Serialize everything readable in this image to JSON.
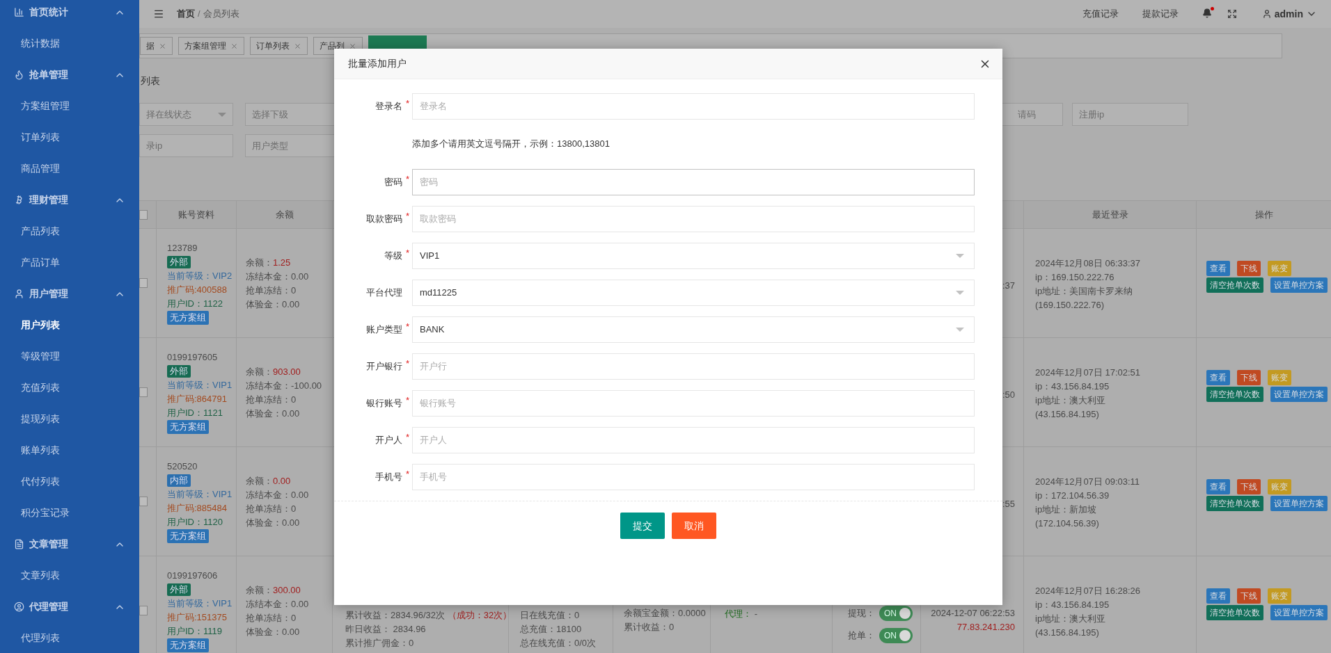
{
  "sidebar": {
    "groups": [
      {
        "label": "首页统计",
        "expanded": true,
        "items": [
          {
            "label": "统计数据",
            "selected": false
          }
        ]
      },
      {
        "label": "抢单管理",
        "expanded": true,
        "items": [
          {
            "label": "方案组管理",
            "selected": false
          },
          {
            "label": "订单列表",
            "selected": false
          },
          {
            "label": "商品管理",
            "selected": false
          }
        ]
      },
      {
        "label": "理财管理",
        "expanded": true,
        "items": [
          {
            "label": "产品列表",
            "selected": false
          },
          {
            "label": "产品订单",
            "selected": false
          }
        ]
      },
      {
        "label": "用户管理",
        "expanded": true,
        "items": [
          {
            "label": "用户列表",
            "selected": true
          },
          {
            "label": "等级管理",
            "selected": false
          },
          {
            "label": "充值列表",
            "selected": false
          },
          {
            "label": "提现列表",
            "selected": false
          },
          {
            "label": "账单列表",
            "selected": false
          },
          {
            "label": "代付列表",
            "selected": false
          },
          {
            "label": "积分宝记录",
            "selected": false
          }
        ]
      },
      {
        "label": "文章管理",
        "expanded": true,
        "items": [
          {
            "label": "文章列表",
            "selected": false
          }
        ]
      },
      {
        "label": "代理管理",
        "expanded": true,
        "items": [
          {
            "label": "代理列表",
            "selected": false
          }
        ]
      }
    ]
  },
  "topbar": {
    "breadcrumb": [
      "首页",
      "会员列表"
    ],
    "separator": "/",
    "links": [
      "充值记录",
      "提款记录"
    ],
    "unread": true,
    "user": "admin"
  },
  "tabs": [
    {
      "label": "据",
      "selected": false
    },
    {
      "label": "方案组管理",
      "selected": false
    },
    {
      "label": "订单列表",
      "selected": false
    },
    {
      "label": "产品列",
      "selected": false
    },
    {
      "selected": true
    }
  ],
  "page_title": "列表",
  "filters": {
    "row_1": [
      {
        "kind": "select",
        "placeholder": "择在线状态"
      },
      {
        "kind": "input",
        "placeholder": "选择下级"
      }
    ],
    "row_1_right": [
      {
        "kind": "input",
        "placeholder": "请码"
      },
      {
        "kind": "input",
        "placeholder": "注册ip"
      }
    ],
    "row_2": [
      {
        "kind": "input",
        "placeholder": "录ip"
      },
      {
        "kind": "input",
        "placeholder": "用户类型"
      }
    ]
  },
  "table": {
    "select_all_checked": false,
    "columns": {
      "account": "账号资料",
      "balance": "余额",
      "last_login": "最近登录",
      "actions": "操作"
    },
    "rows": [
      {
        "checked": false,
        "account": {
          "name": "123789",
          "tag": {
            "kind": "external",
            "label": "外部"
          },
          "level": "当前等级：VIP2",
          "promo": "推广码:400588",
          "user_id": "用户ID：1122",
          "group": "无方案组"
        },
        "balance": {
          "label": "余额：",
          "value": "1.25",
          "lines": [
            "冻结本金：0.00",
            "抢单冻结：0",
            "体验金：0.00"
          ]
        },
        "register": [
          ":37"
        ],
        "last_login": [
          "2024年12月08日 06:33:37",
          "ip：169.150.222.76",
          "ip地址：美国南卡罗来纳",
          "(169.150.222.76)"
        ],
        "actions": [
          "查看",
          "下线",
          "账变",
          "清空抢单次数",
          "设置单控方案"
        ]
      },
      {
        "checked": false,
        "account": {
          "name": "0199197605",
          "tag": {
            "kind": "external",
            "label": "外部"
          },
          "level": "当前等级：VIP1",
          "promo": "推广码:864791",
          "user_id": "用户ID：1121",
          "group": "无方案组"
        },
        "balance": {
          "label": "余额：",
          "value": "903.00",
          "lines": [
            "冻结本金：-100.00",
            "抢单冻结：0",
            "体验金：0.00"
          ]
        },
        "register": [
          ":50"
        ],
        "last_login": [
          "2024年12月07日 17:02:51",
          "ip：43.156.84.195",
          "ip地址：澳大利亚",
          "(43.156.84.195)"
        ],
        "actions": [
          "查看",
          "下线",
          "账变",
          "清空抢单次数",
          "设置单控方案"
        ]
      },
      {
        "checked": false,
        "account": {
          "name": "520520",
          "tag": {
            "kind": "internal",
            "label": "内部"
          },
          "level": "当前等级：VIP1",
          "promo": "推广码:885484",
          "user_id": "用户ID：1120",
          "group": "无方案组"
        },
        "balance": {
          "label": "余额：",
          "value": "0.00",
          "lines": [
            "冻结本金：0.00",
            "抢单冻结：0",
            "体验金：0.00"
          ]
        },
        "register": [
          ":55"
        ],
        "last_login": [
          "2024年12月07日 09:03:11",
          "ip：172.104.56.39",
          "ip地址：新加坡",
          "(172.104.56.39)"
        ],
        "actions": [
          "查看",
          "下线",
          "账变",
          "清空抢单次数",
          "设置单控方案"
        ]
      },
      {
        "checked": false,
        "account": {
          "name": "0199197606",
          "tag": {
            "kind": "external",
            "label": "外部"
          },
          "level": "当前等级：VIP1",
          "promo": "推广码:151375",
          "user_id": "用户ID：1119",
          "group": "无方案组"
        },
        "balance": {
          "label": "余额：",
          "value": "300.00",
          "lines": [
            "冻结本金：0.00",
            "抢单冻结：0",
            "体验金：0.00"
          ]
        },
        "income": {
          "lines": [
            "累计收益：2834.96/32次",
            "昨日收益： 2834.96",
            "累计推广佣金：0"
          ],
          "note": "（成功：32次）"
        },
        "recharge": [
          "日在线充值：0",
          "总充值：18100",
          "总在线充值：0/0次"
        ],
        "yuebao": [
          "余额宝金额：0.0000",
          "累计收益：0"
        ],
        "agent": {
          "label": "代理：",
          "value": "-"
        },
        "switches": [
          {
            "label": "提现：",
            "on": true,
            "text": "ON"
          },
          {
            "label": "抢单：",
            "on": true,
            "text": "ON"
          }
        ],
        "register": [
          "2024-12-07 06:22:53",
          "77.83.241.230"
        ],
        "last_login": [
          "2024年12月07日 16:28:26",
          "ip：43.156.84.195",
          "ip地址：澳大利亚",
          "(43.156.84.195)"
        ],
        "actions": [
          "查看",
          "下线",
          "账变",
          "清空抢单次数",
          "设置单控方案"
        ]
      }
    ]
  },
  "dialog": {
    "title": "批量添加用户",
    "required_mark": "*",
    "fields": [
      {
        "kind": "input",
        "label": "登录名",
        "required": true,
        "placeholder": "登录名",
        "focused": false
      },
      {
        "kind": "hint",
        "text": "添加多个请用英文逗号隔开，示例：13800,13801"
      },
      {
        "kind": "input",
        "label": "密码",
        "required": true,
        "placeholder": "密码",
        "focused": true
      },
      {
        "kind": "input",
        "label": "取款密码",
        "required": true,
        "placeholder": "取款密码",
        "focused": false
      },
      {
        "kind": "select",
        "label": "等级",
        "required": true,
        "value": "VIP1",
        "focused": false
      },
      {
        "kind": "select",
        "label": "平台代理",
        "required": false,
        "value": "md11225",
        "focused": false
      },
      {
        "kind": "select",
        "label": "账户类型",
        "required": true,
        "value": "BANK",
        "focused": false
      },
      {
        "kind": "input",
        "label": "开户银行",
        "required": true,
        "placeholder": "开户行",
        "focused": false
      },
      {
        "kind": "input",
        "label": "银行账号",
        "required": true,
        "placeholder": "银行账号",
        "focused": false
      },
      {
        "kind": "input",
        "label": "开户人",
        "required": true,
        "placeholder": "开户人",
        "focused": false
      },
      {
        "kind": "input",
        "label": "手机号",
        "required": true,
        "placeholder": "手机号",
        "focused": false
      }
    ],
    "buttons": [
      {
        "kind": "primary",
        "label": "提交"
      },
      {
        "kind": "danger",
        "label": "取消"
      }
    ]
  }
}
